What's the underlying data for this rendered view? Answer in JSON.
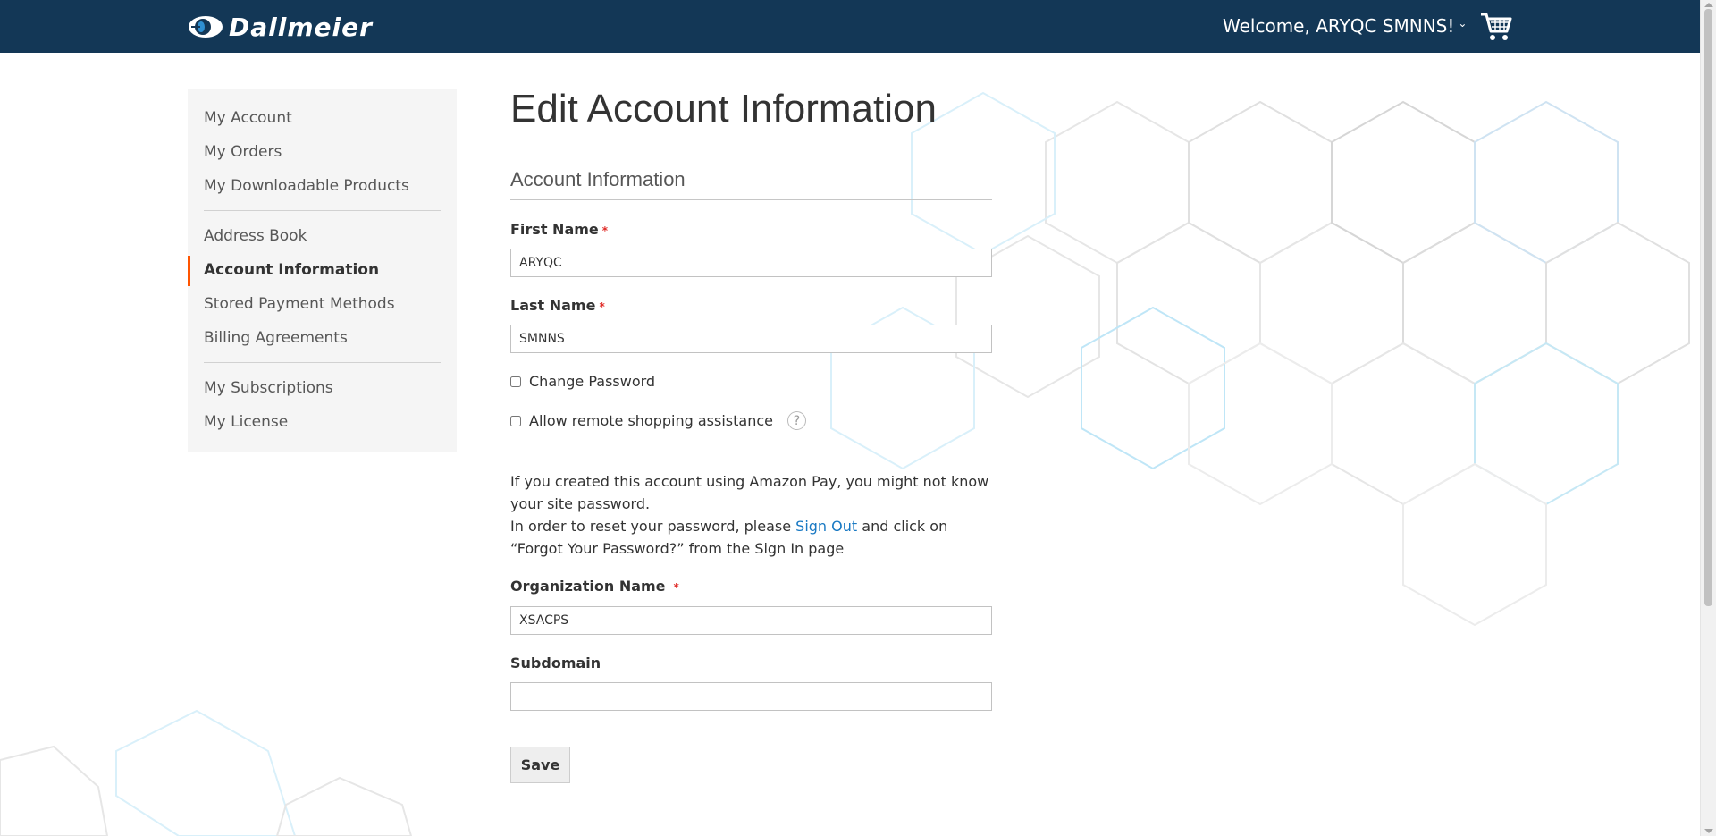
{
  "header": {
    "brand": "Dallmeier",
    "welcome": "Welcome, ARYQC SMNNS!",
    "cart_icon": "shopping-cart-icon",
    "background_color": "#133756"
  },
  "sidebar": {
    "items": [
      {
        "label": "My Account"
      },
      {
        "label": "My Orders"
      },
      {
        "label": "My Downloadable Products"
      },
      {
        "label": "Address Book"
      },
      {
        "label": "Account Information",
        "active": true
      },
      {
        "label": "Stored Payment Methods"
      },
      {
        "label": "Billing Agreements"
      },
      {
        "label": "My Subscriptions"
      },
      {
        "label": "My License"
      }
    ],
    "accent_color": "#ff5501"
  },
  "main": {
    "title": "Edit Account Information",
    "section_title": "Account Information",
    "first_name": {
      "label": "First Name",
      "required_mark": "*",
      "value": "ARYQC"
    },
    "last_name": {
      "label": "Last Name",
      "required_mark": "*",
      "value": "SMNNS"
    },
    "change_password": {
      "label": "Change Password",
      "checked": false
    },
    "remote_assistance": {
      "label": "Allow remote shopping assistance",
      "checked": false,
      "help": "?"
    },
    "note": {
      "line1": "If you created this account using Amazon Pay, you might not know your site password.",
      "line2_before": "In order to reset your password, please ",
      "link": "Sign Out",
      "line2_after": " and click on “Forgot Your Password?” from the Sign In page",
      "link_color": "#1979c3"
    },
    "organization": {
      "label": "Organization Name",
      "required_mark": "*",
      "value": "XSACPS"
    },
    "subdomain": {
      "label": "Subdomain",
      "value": ""
    },
    "save_label": "Save"
  }
}
